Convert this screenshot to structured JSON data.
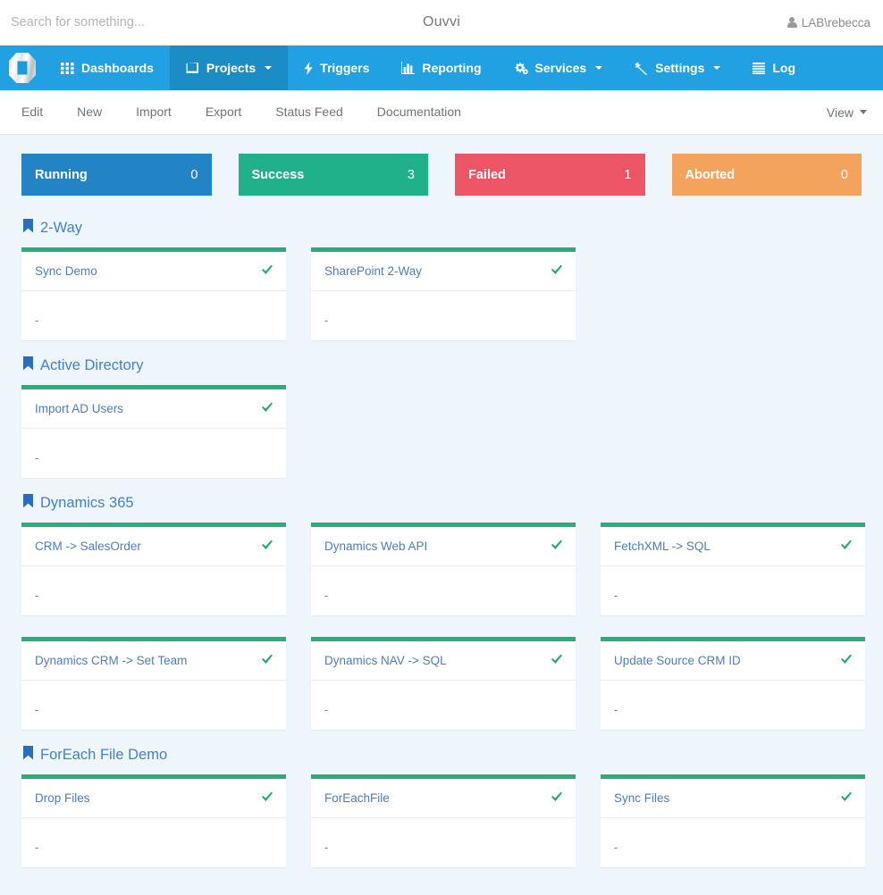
{
  "topbar": {
    "search_placeholder": "Search for something...",
    "search_value": "",
    "app_title": "Ouvvi",
    "user_label": "LAB\\rebecca",
    "user_icon": "user-icon"
  },
  "navbar": {
    "brand_icon": "ouvvi-logo-icon",
    "items": [
      {
        "label": "Dashboards",
        "icon": "grid-icon",
        "active": false,
        "caret": false
      },
      {
        "label": "Projects",
        "icon": "book-icon",
        "active": true,
        "caret": true
      },
      {
        "label": "Triggers",
        "icon": "bolt-icon",
        "active": false,
        "caret": false
      },
      {
        "label": "Reporting",
        "icon": "bar-chart-icon",
        "active": false,
        "caret": false
      },
      {
        "label": "Services",
        "icon": "gears-icon",
        "active": false,
        "caret": true
      },
      {
        "label": "Settings",
        "icon": "magic-wand-icon",
        "active": false,
        "caret": true
      },
      {
        "label": "Log",
        "icon": "list-icon",
        "active": false,
        "caret": false
      }
    ]
  },
  "subnav": {
    "items": [
      {
        "label": "Edit"
      },
      {
        "label": "New"
      },
      {
        "label": "Import"
      },
      {
        "label": "Export"
      },
      {
        "label": "Status Feed"
      },
      {
        "label": "Documentation"
      }
    ],
    "view_label": "View",
    "view_caret_icon": "chevron-down-icon"
  },
  "stats": [
    {
      "label": "Running",
      "value": "0",
      "color": "#2284c5"
    },
    {
      "label": "Success",
      "value": "3",
      "color": "#21b189"
    },
    {
      "label": "Failed",
      "value": "1",
      "color": "#ec5565"
    },
    {
      "label": "Aborted",
      "value": "0",
      "color": "#f4a council"
    }
  ],
  "stats_fixed": [
    {
      "label": "Running",
      "value": "0",
      "color": "#2284c5"
    },
    {
      "label": "Success",
      "value": "3",
      "color": "#21b189"
    },
    {
      "label": "Failed",
      "value": "1",
      "color": "#ec5565"
    },
    {
      "label": "Aborted",
      "value": "0",
      "color": "#f4a35d"
    }
  ],
  "groups": [
    {
      "title": "2-Way",
      "icon": "bookmark-icon",
      "rows": [
        [
          {
            "title": "Sync Demo",
            "status_icon": "check-icon",
            "detail": "-",
            "accent": "#27ae79"
          },
          {
            "title": "SharePoint 2-Way",
            "status_icon": "check-icon",
            "detail": "-",
            "accent": "#27ae79"
          }
        ]
      ]
    },
    {
      "title": "Active Directory",
      "icon": "bookmark-icon",
      "rows": [
        [
          {
            "title": "Import AD Users",
            "status_icon": "check-icon",
            "detail": "-",
            "accent": "#27ae79"
          }
        ]
      ]
    },
    {
      "title": "Dynamics 365",
      "icon": "bookmark-icon",
      "rows": [
        [
          {
            "title": "CRM -> SalesOrder",
            "status_icon": "check-icon",
            "detail": "-",
            "accent": "#27ae79"
          },
          {
            "title": "Dynamics Web API",
            "status_icon": "check-icon",
            "detail": "-",
            "accent": "#27ae79"
          },
          {
            "title": "FetchXML -> SQL",
            "status_icon": "check-icon",
            "detail": "-",
            "accent": "#27ae79"
          }
        ],
        [
          {
            "title": "Dynamics CRM -> Set Team",
            "status_icon": "check-icon",
            "detail": "-",
            "accent": "#27ae79"
          },
          {
            "title": "Dynamics NAV -> SQL",
            "status_icon": "check-icon",
            "detail": "-",
            "accent": "#27ae79"
          },
          {
            "title": "Update Source CRM ID",
            "status_icon": "check-icon",
            "detail": "-",
            "accent": "#27ae79"
          }
        ]
      ]
    },
    {
      "title": "ForEach File Demo",
      "icon": "bookmark-icon",
      "rows": [
        [
          {
            "title": "Drop Files",
            "status_icon": "check-icon",
            "detail": "-",
            "accent": "#27ae79"
          },
          {
            "title": "ForEachFile",
            "status_icon": "check-icon",
            "detail": "-",
            "accent": "#27ae79"
          },
          {
            "title": "Sync Files",
            "status_icon": "check-icon",
            "detail": "-",
            "accent": "#27ae79"
          }
        ]
      ]
    }
  ],
  "colors": {
    "nav_blue": "#21a1e1",
    "nav_active": "#1b8cc4",
    "page_bg": "#eef5fb",
    "card_accent": "#27ae79",
    "group_title": "#4083c4",
    "card_title": "#4a7fbd"
  }
}
